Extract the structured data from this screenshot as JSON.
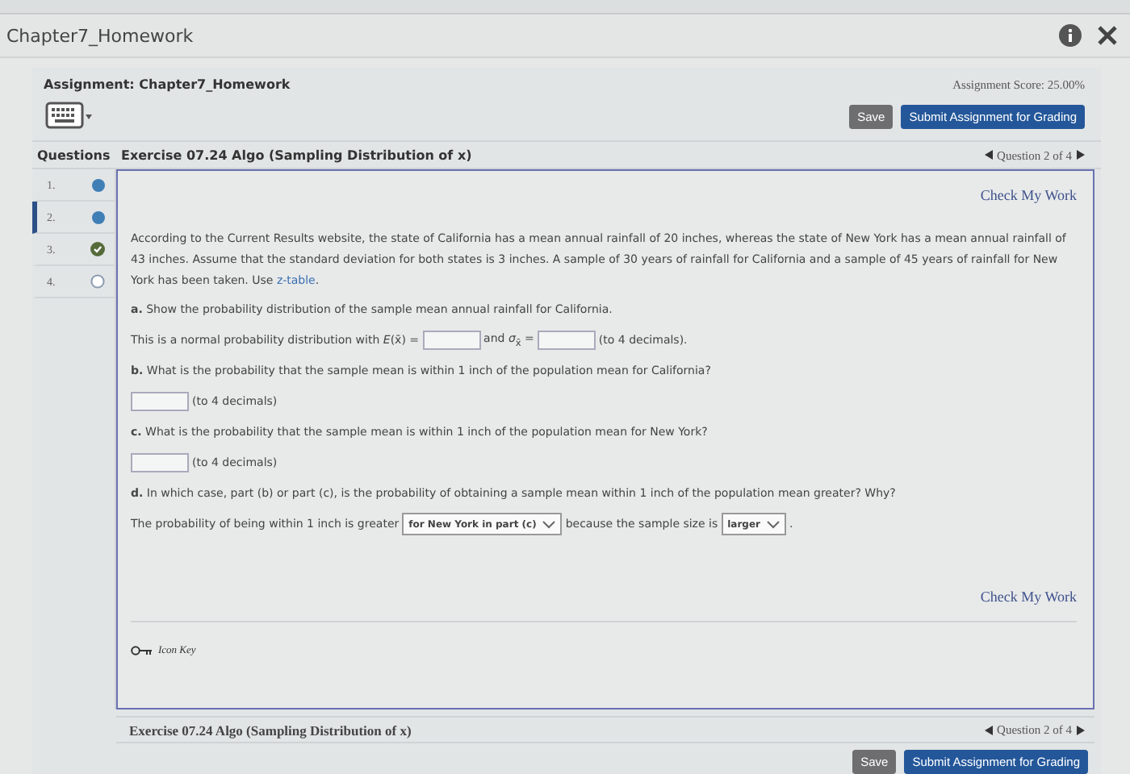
{
  "window": {
    "title": "Chapter7_Homework"
  },
  "assignment": {
    "title": "Assignment: Chapter7_Homework",
    "score": "Assignment Score: 25.00%"
  },
  "toolbar": {
    "buttons": [
      {
        "label": "Save",
        "kind": "secondary"
      },
      {
        "label": "Submit Assignment for Grading",
        "kind": "primary"
      }
    ]
  },
  "questions_panel": {
    "heading": "Questions",
    "items": [
      {
        "number": "1.",
        "kind": "answered",
        "selected": false
      },
      {
        "number": "2.",
        "kind": "answered",
        "selected": true
      },
      {
        "number": "3.",
        "kind": "checked",
        "selected": false
      },
      {
        "number": "4.",
        "kind": "empty",
        "selected": false
      }
    ]
  },
  "exercise": {
    "title": "Exercise 07.24 Algo (Sampling Distribution of x)",
    "nav": "Question 2 of 4"
  },
  "content": {
    "top_link": "Check My Work",
    "intro": [
      {
        "kind": "text",
        "text": "According to the Current Results website, the state of California has a mean annual rainfall of 20 inches, whereas the state of New York has a mean annual rainfall of 43 inches. Assume that the standard deviation for both states is 3 inches. A sample of 30 years of rainfall for California and a sample of 45 years of rainfall for New York has been taken. Use "
      },
      {
        "kind": "link",
        "text": "z-table"
      },
      {
        "kind": "text",
        "text": "."
      }
    ],
    "lines": [
      {
        "kind": "prompt",
        "text": "**a.** Show the probability distribution of the sample mean annual rainfall for California."
      },
      {
        "kind": "answer",
        "segments": [
          {
            "kind": "text",
            "text": "This is a normal probability distribution with *E*(x̄) ="
          },
          {
            "kind": "field"
          },
          {
            "kind": "text",
            "text": "and *σ*$_{x̄}$ ="
          },
          {
            "kind": "field"
          },
          {
            "kind": "text",
            "text": "(to 4 decimals)."
          }
        ]
      },
      {
        "kind": "prompt",
        "text": "**b.** What is the probability that the sample mean is within 1 inch of the population mean for California?"
      },
      {
        "kind": "answer",
        "segments": [
          {
            "kind": "field"
          },
          {
            "kind": "text",
            "text": "(to 4 decimals)"
          }
        ]
      },
      {
        "kind": "prompt",
        "text": "**c.** What is the probability that the sample mean is within 1 inch of the population mean for New York?"
      },
      {
        "kind": "answer",
        "segments": [
          {
            "kind": "field"
          },
          {
            "kind": "text",
            "text": "(to 4 decimals)"
          }
        ]
      },
      {
        "kind": "prompt",
        "text": "**d.** In which case, part (b) or part (c), is the probability of obtaining a sample mean within 1 inch of the population mean greater? Why?"
      },
      {
        "kind": "answer",
        "segments": [
          {
            "kind": "text",
            "text": "The probability of being within 1 inch is greater"
          },
          {
            "kind": "dropdown",
            "value": "for New York in part (c)"
          },
          {
            "kind": "text",
            "text": "because the sample size is"
          },
          {
            "kind": "dropdown",
            "value": "larger"
          },
          {
            "kind": "text",
            "text": "."
          }
        ]
      }
    ],
    "bottom_link": "Check My Work",
    "icon_key": "Icon Key"
  },
  "footer": {
    "title": "Exercise 07.24 Algo (Sampling Distribution of x)",
    "nav": "Question 2 of 4",
    "buttons": [
      {
        "label": "Save",
        "kind": "secondary"
      },
      {
        "label": "Submit Assignment for Grading",
        "kind": "primary"
      }
    ]
  }
}
